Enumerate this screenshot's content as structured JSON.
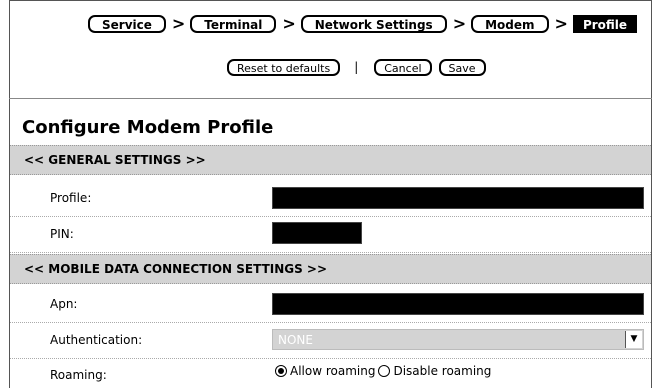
{
  "breadcrumb": {
    "items": [
      "Service",
      "Terminal",
      "Network Settings",
      "Modem"
    ],
    "current": "Profile",
    "separator": ">"
  },
  "actions": {
    "reset_label": "Reset to defaults",
    "divider": "|",
    "cancel_label": "Cancel",
    "save_label": "Save"
  },
  "page_title": "Configure Modem Profile",
  "sections": {
    "general": "<<  GENERAL SETTINGS  >>",
    "mobile": "<<  MOBILE DATA CONNECTION SETTINGS  >>"
  },
  "fields": {
    "profile_label": "Profile:",
    "pin_label": "PIN:",
    "apn_label": "Apn:",
    "auth_label": "Authentication:",
    "auth_value": "NONE",
    "roaming_label": "Roaming:",
    "roaming_allow": "Allow roaming",
    "roaming_disable": "Disable roaming",
    "roaming_selected": "allow"
  },
  "icons": {
    "dropdown": "chevron-down-icon"
  }
}
